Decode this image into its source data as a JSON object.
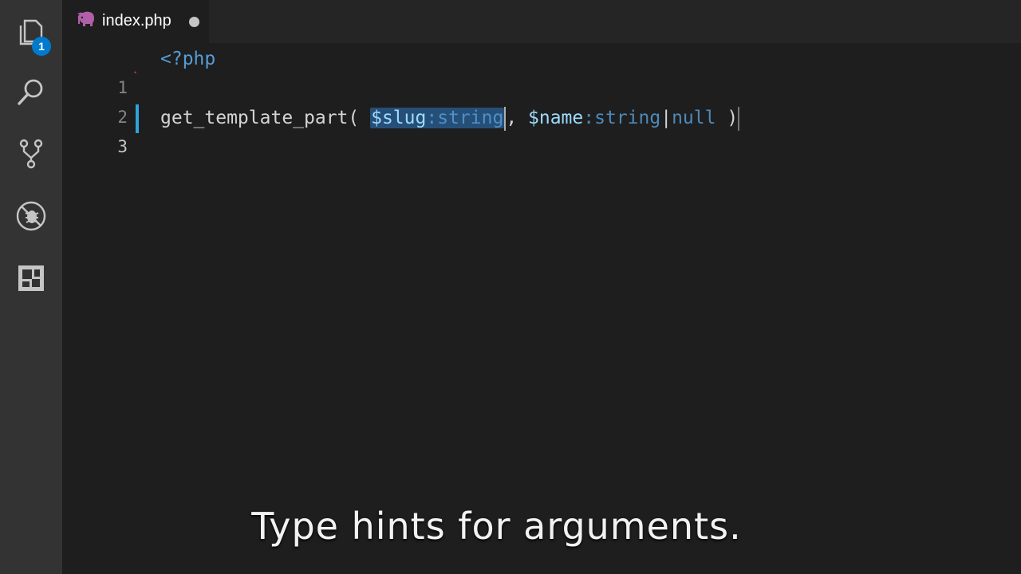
{
  "activity_bar": {
    "items": [
      {
        "icon": "explorer-icon",
        "badge": "1"
      },
      {
        "icon": "search-icon"
      },
      {
        "icon": "source-control-icon"
      },
      {
        "icon": "debug-icon"
      },
      {
        "icon": "extensions-icon"
      }
    ]
  },
  "tab": {
    "icon": "php-elephant-icon",
    "label": "index.php",
    "dirty": true
  },
  "editor": {
    "lines": [
      {
        "number": "1",
        "open_tag": "<?php"
      },
      {
        "number": "2"
      },
      {
        "number": "3",
        "function": "get_template_part",
        "open_paren": "( ",
        "param1_name": "$slug",
        "param1_sep": ":",
        "param1_type": "string",
        "comma": ", ",
        "param2_name": "$name",
        "param2_sep": ":",
        "param2_type": "string",
        "param2_union": "|",
        "param2_type2": "null",
        "close_paren": " )"
      }
    ]
  },
  "subtitle": "Type hints for arguments.",
  "colors": {
    "activity_bar": "#333333",
    "editor_bg": "#1e1e1e",
    "tab_bar": "#252526",
    "badge": "#007acc",
    "keyword": "#569cd6",
    "selection": "#264f78"
  }
}
